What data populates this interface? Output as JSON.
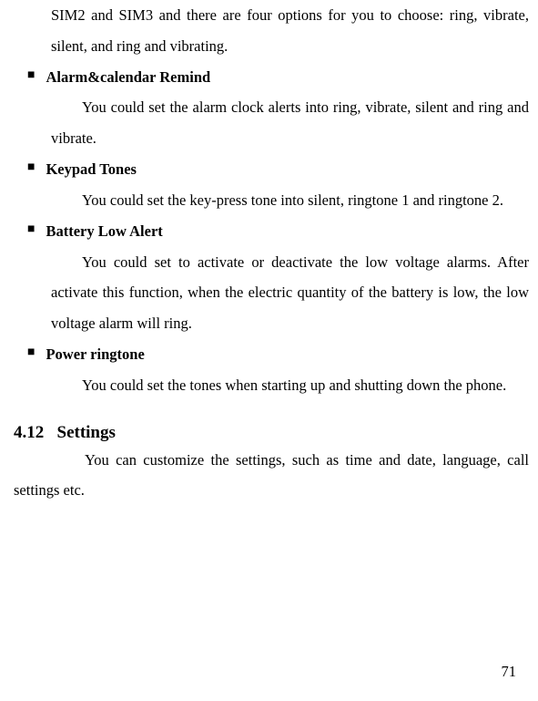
{
  "continued": "SIM2 and SIM3 and there are four options for you to choose: ring, vibrate, silent, and ring and vibrating.",
  "items": [
    {
      "heading": "Alarm&calendar Remind",
      "body": "You could set the alarm clock alerts into ring, vibrate, silent and ring and vibrate."
    },
    {
      "heading": "Keypad Tones",
      "body": "You could set the key-press tone into silent, ringtone 1 and ringtone 2."
    },
    {
      "heading": "Battery Low Alert",
      "body": "You could set to activate or deactivate the low voltage alarms. After activate this function, when the electric quantity of the battery is low, the low voltage alarm will ring."
    },
    {
      "heading": "Power ringtone",
      "body": "You could set the tones when starting up and shutting down the phone."
    }
  ],
  "section": {
    "number": "4.12",
    "title": "Settings",
    "body": "You can customize the settings, such as time and date, language, call settings etc."
  },
  "pageNumber": "71"
}
